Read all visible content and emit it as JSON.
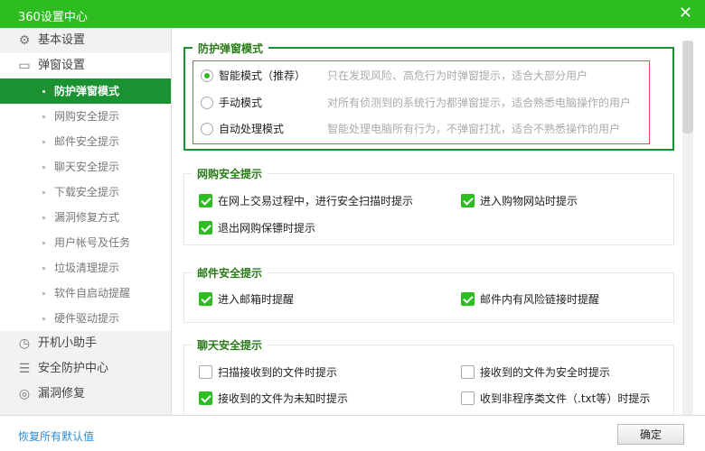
{
  "window": {
    "title": "360设置中心",
    "close": "✕"
  },
  "sidebar": {
    "groups_top": [
      {
        "label": "基本设置",
        "icon": "gear-icon"
      },
      {
        "label": "弹窗设置",
        "icon": "window-icon"
      }
    ],
    "sub_items": [
      "防护弹窗模式",
      "网购安全提示",
      "邮件安全提示",
      "聊天安全提示",
      "下载安全提示",
      "漏洞修复方式",
      "用户帐号及任务",
      "垃圾清理提示",
      "软件自启动提醒",
      "硬件驱动提示"
    ],
    "groups_bottom": [
      {
        "label": "开机小助手",
        "icon": "stopwatch-icon"
      },
      {
        "label": "安全防护中心",
        "icon": "shield-grid-icon"
      },
      {
        "label": "漏洞修复",
        "icon": "repair-icon"
      }
    ]
  },
  "popup_mode": {
    "title": "防护弹窗模式",
    "options": [
      {
        "label": "智能模式（推荐）",
        "desc": "只在发现风险、高危行为时弹窗提示，适合大部分用户",
        "selected": true
      },
      {
        "label": "手动模式",
        "desc": "对所有侦测到的系统行为都弹窗提示，适合熟悉电脑操作的用户",
        "selected": false
      },
      {
        "label": "自动处理模式",
        "desc": "智能处理电脑所有行为，不弹窗打扰，适合不熟悉操作的用户",
        "selected": false
      }
    ]
  },
  "shopping": {
    "title": "网购安全提示",
    "items": [
      {
        "label": "在网上交易过程中，进行安全扫描时提示",
        "checked": true
      },
      {
        "label": "进入购物网站时提示",
        "checked": true
      },
      {
        "label": "退出网购保镖时提示",
        "checked": true
      }
    ]
  },
  "mail": {
    "title": "邮件安全提示",
    "items": [
      {
        "label": "进入邮箱时提醒",
        "checked": true
      },
      {
        "label": "邮件内有风险链接时提醒",
        "checked": true
      }
    ]
  },
  "chat": {
    "title": "聊天安全提示",
    "items": [
      {
        "label": "扫描接收到的文件时提示",
        "checked": false
      },
      {
        "label": "接收到的文件为安全时提示",
        "checked": false
      },
      {
        "label": "接收到的文件为未知时提示",
        "checked": true
      },
      {
        "label": "收到非程序类文件（.txt等）时提示",
        "checked": false
      }
    ]
  },
  "footer": {
    "restore": "恢复所有默认值",
    "ok": "确定"
  },
  "colors": {
    "brand": "#2dbd21",
    "active": "#1a9232"
  }
}
